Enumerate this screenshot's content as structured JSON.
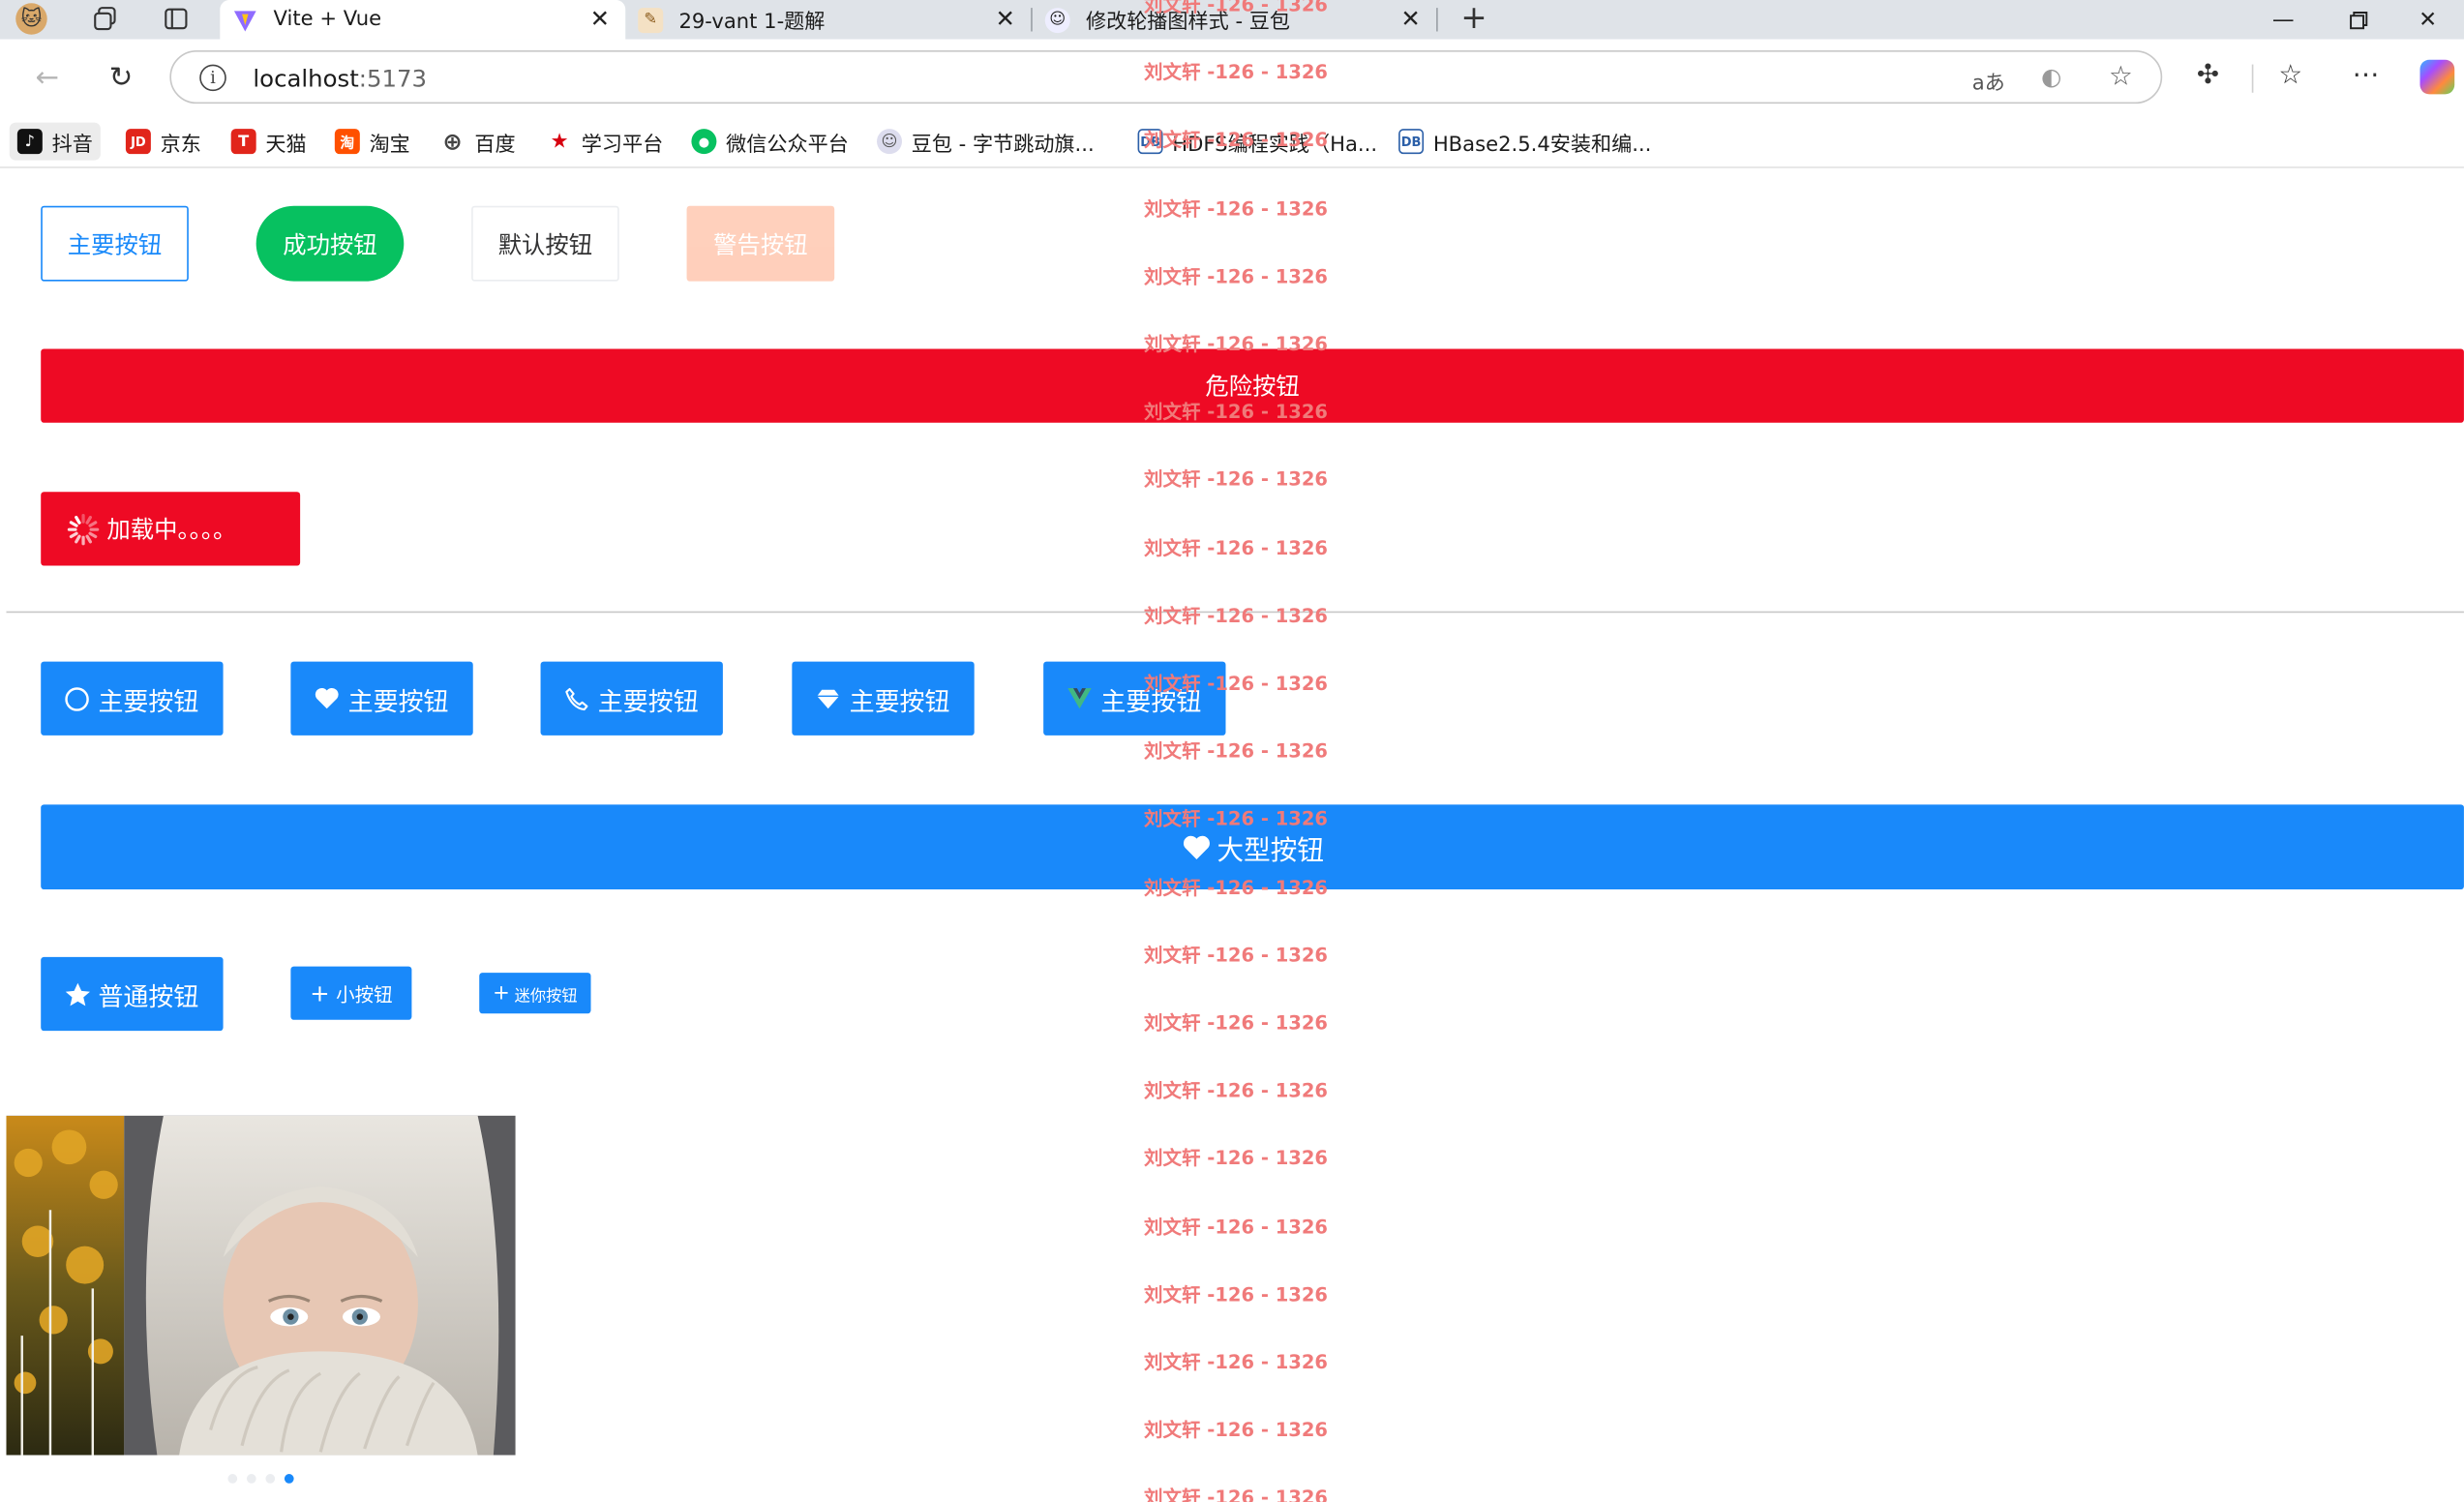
{
  "browser": {
    "tabs": [
      {
        "title": "Vite + Vue",
        "favicon": "vite-logo-icon",
        "active": true
      },
      {
        "title": "29-vant 1-题解",
        "favicon": "page-icon",
        "active": false
      },
      {
        "title": "修改轮播图样式 - 豆包",
        "favicon": "doubao-avatar-icon",
        "active": false
      }
    ],
    "url_host": "localhost",
    "url_port": ":5173",
    "bookmarks": [
      {
        "label": "抖音",
        "color": "#111111",
        "glyph": "♪"
      },
      {
        "label": "京东",
        "color": "#e1251b",
        "glyph": "JD"
      },
      {
        "label": "天猫",
        "color": "#e1251b",
        "glyph": "T"
      },
      {
        "label": "淘宝",
        "color": "#ff5000",
        "glyph": "淘"
      },
      {
        "label": "百度",
        "color": "#444444",
        "glyph": "⊕"
      },
      {
        "label": "学习平台",
        "color": "#d7000f",
        "glyph": "★"
      },
      {
        "label": "微信公众平台",
        "color": "#07c160",
        "glyph": "●"
      },
      {
        "label": "豆包 - 字节跳动旗...",
        "color": "#888888",
        "glyph": "◉"
      },
      {
        "label": "HDFS编程实践（Ha...",
        "color": "#2b5fa8",
        "glyph": "DB"
      },
      {
        "label": "HBase2.5.4安装和编...",
        "color": "#2b5fa8",
        "glyph": "DB"
      }
    ]
  },
  "buttons": {
    "primary_plain": "主要按钮",
    "success_round": "成功按钮",
    "default": "默认按钮",
    "warning_disabled": "警告按钮",
    "danger_block": "危险按钮",
    "loading": "加载中。。。。",
    "icon_buttons": [
      {
        "label": "主要按钮",
        "icon": "circle-icon"
      },
      {
        "label": "主要按钮",
        "icon": "heart-icon"
      },
      {
        "label": "主要按钮",
        "icon": "phone-icon"
      },
      {
        "label": "主要按钮",
        "icon": "diamond-icon"
      },
      {
        "label": "主要按钮",
        "icon": "vant-logo-icon"
      }
    ],
    "large": "大型按钮",
    "normal": "普通按钮",
    "small": "小按钮",
    "mini": "迷你按钮"
  },
  "swipe": {
    "slide_count": 4,
    "active_index": 3
  },
  "watermark": "刘文轩 -126 - 1326",
  "colors": {
    "primary": "#1989fa",
    "success": "#07c160",
    "danger": "#ee0a24",
    "warning": "#ff976a",
    "watermark": "#f07a7a"
  }
}
